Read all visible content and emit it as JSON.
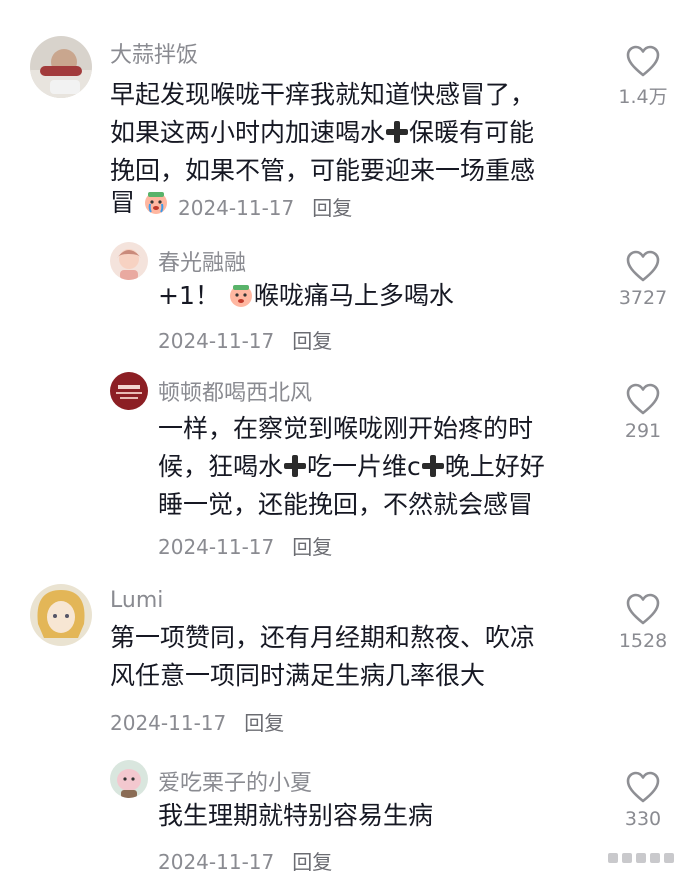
{
  "comments": [
    {
      "author": "大蒜拌饭",
      "lines": [
        "早起发现喉咙干痒我就知道快感冒了，",
        "如果这两小时内加速喝水",
        "保暖有可能",
        "挽回，如果不管，可能要迎来一场重感",
        "冒"
      ],
      "date": "2024-11-17",
      "reply": "回复",
      "likes": "1.4万"
    },
    {
      "author": "春光融融",
      "text_a": "+1！",
      "text_b": "喉咙痛马上多喝水",
      "date": "2024-11-17",
      "reply": "回复",
      "likes": "3727"
    },
    {
      "author": "顿顿都喝西北风",
      "lines": [
        "一样，在察觉到喉咙刚开始疼的时",
        "候，狂喝水",
        "吃一片维c",
        "晚上好好",
        "睡一觉，还能挽回，不然就会感冒"
      ],
      "date": "2024-11-17",
      "reply": "回复",
      "likes": "291"
    },
    {
      "author": "Lumi",
      "lines": [
        "第一项赞同，还有月经期和熬夜、吹凉",
        "风任意一项同时满足生病几率很大"
      ],
      "date": "2024-11-17",
      "reply": "回复",
      "likes": "1528"
    },
    {
      "author": "爱吃栗子的小夏",
      "lines": [
        "我生理期就特别容易生病"
      ],
      "date": "2024-11-17",
      "reply": "回复",
      "likes": "330"
    }
  ],
  "icons": {
    "like": "heart-outline-icon",
    "plus": "heavy-plus-emoji",
    "cry": "crying-face-emoji"
  },
  "colors": {
    "text": "#161823",
    "muted": "#8a8b91"
  }
}
